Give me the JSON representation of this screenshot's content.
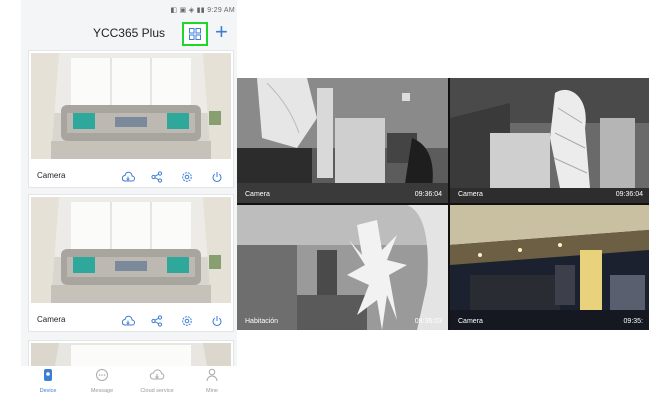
{
  "phone": {
    "status_time": "9:29 AM",
    "app_title": "YCC365 Plus",
    "cards": [
      {
        "camera_label": "Camera"
      },
      {
        "camera_label": "Camera"
      }
    ],
    "tabs": [
      {
        "label": "Device",
        "icon": "device-icon",
        "active": true
      },
      {
        "label": "Message",
        "icon": "message-icon",
        "active": false
      },
      {
        "label": "Cloud service",
        "icon": "cloud-service-icon",
        "active": false
      },
      {
        "label": "Mine",
        "icon": "person-icon",
        "active": false
      }
    ],
    "accent_color": "#3b7dd8",
    "highlight_color": "#1fd62a"
  },
  "grid": {
    "tiles": [
      {
        "label": "Camera",
        "time": "09:36:04"
      },
      {
        "label": "Camera",
        "time": "09:36:04"
      },
      {
        "label": "Habitación",
        "time": "09:36:03"
      },
      {
        "label": "Camera",
        "time": "09:35:"
      }
    ]
  }
}
